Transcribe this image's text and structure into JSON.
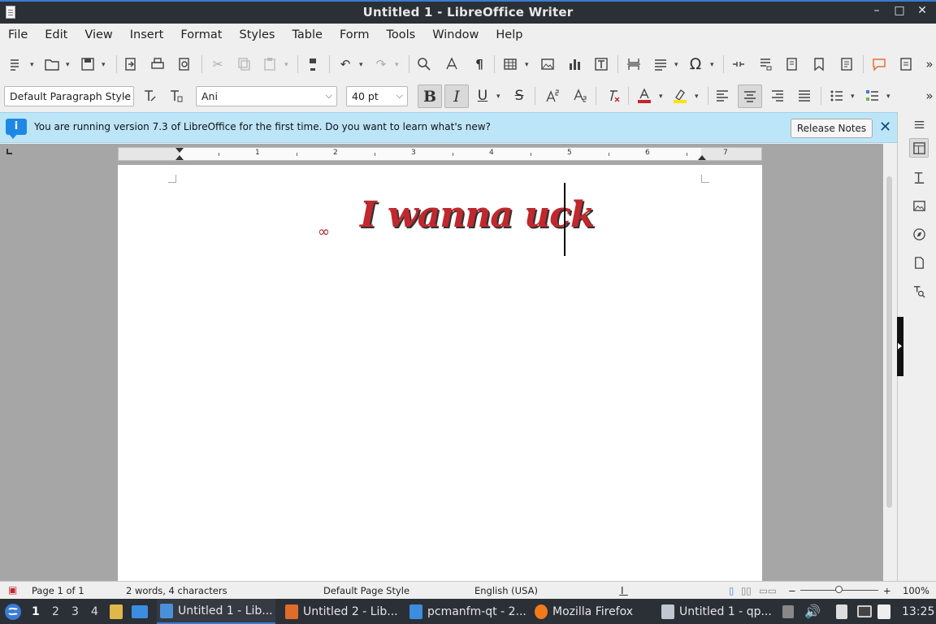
{
  "window": {
    "title": "Untitled 1 - LibreOffice Writer",
    "minimize": "–",
    "maximize": "□",
    "close": "✕"
  },
  "menu": [
    "File",
    "Edit",
    "View",
    "Insert",
    "Format",
    "Styles",
    "Table",
    "Form",
    "Tools",
    "Window",
    "Help"
  ],
  "formatting": {
    "paragraph_style": "Default Paragraph Style",
    "font_name": "Ani",
    "font_size": "40 pt",
    "bold": "B",
    "italic": "I",
    "underline": "U",
    "strikethrough": "S"
  },
  "infobar": {
    "message": "You are running version 7.3 of LibreOffice for the first time. Do you want to learn what's new?",
    "button": "Release Notes",
    "close": "✕"
  },
  "ruler": {
    "numbers": [
      "1",
      "2",
      "3",
      "4",
      "5",
      "6",
      "7"
    ]
  },
  "document": {
    "symbol": "∞",
    "text": "I wanna uck"
  },
  "status": {
    "page": "Page 1 of 1",
    "words": "2 words, 4 characters",
    "page_style": "Default Page Style",
    "language": "English (USA)",
    "zoom": "100%",
    "zoom_minus": "−",
    "zoom_plus": "+"
  },
  "taskbar": {
    "workspaces": [
      "1",
      "2",
      "3",
      "4"
    ],
    "tasks": [
      {
        "label": "Untitled 1 - Lib...",
        "color": "#4a90d9"
      },
      {
        "label": "Untitled 2 - Lib...",
        "color": "#e06c2a"
      },
      {
        "label": "pcmanfm-qt - 2...",
        "color": "#3c8de0"
      },
      {
        "label": "Mozilla Firefox",
        "color": "#f27a1a"
      },
      {
        "label": "Untitled 1 - qp...",
        "color": "#bfc7d2"
      }
    ],
    "clock": "13:25"
  },
  "colors": {
    "accent": "#3a7bd5",
    "font_color": "#c1272d",
    "highlight": "#f5e50a",
    "infobar_bg": "#bde5f8"
  }
}
